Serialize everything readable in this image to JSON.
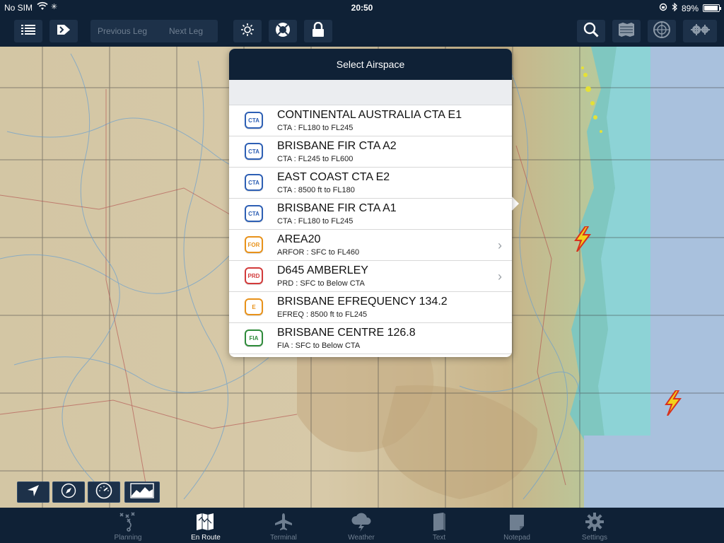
{
  "status": {
    "carrier": "No SIM",
    "time": "20:50",
    "battery_text": "89%",
    "battery_level": 0.89
  },
  "toolbar": {
    "previous_leg": "Previous Leg",
    "next_leg": "Next Leg"
  },
  "popover": {
    "title": "Select Airspace",
    "items": [
      {
        "badge": "CTA",
        "title": "CONTINENTAL AUSTRALIA CTA E1",
        "subtitle": "CTA : FL180 to FL245"
      },
      {
        "badge": "CTA",
        "title": "BRISBANE FIR CTA A2",
        "subtitle": "CTA : FL245 to FL600"
      },
      {
        "badge": "CTA",
        "title": "EAST COAST CTA E2",
        "subtitle": "CTA : 8500 ft to FL180"
      },
      {
        "badge": "CTA",
        "title": "BRISBANE FIR CTA A1",
        "subtitle": "CTA : FL180 to FL245"
      },
      {
        "badge": "FOR",
        "title": "AREA20",
        "subtitle": "ARFOR : SFC to FL460"
      },
      {
        "badge": "PRD",
        "title": "D645 AMBERLEY",
        "subtitle": "PRD : SFC to Below CTA"
      },
      {
        "badge": "E",
        "title": "BRISBANE EFREQUENCY 134.2",
        "subtitle": "EFREQ : 8500 ft to FL245"
      },
      {
        "badge": "FIA",
        "title": "BRISBANE CENTRE 126.8",
        "subtitle": "FIA : SFC to Below CTA"
      }
    ]
  },
  "colors": {
    "cta": "#2d5fb4",
    "for": "#e8921a",
    "prd": "#d23a3a",
    "e": "#e8921a",
    "fia": "#2e8b3a",
    "chrome": "#0f2136",
    "button": "#1d3149"
  },
  "tabs": [
    {
      "label": "Planning",
      "icon": "route-planning-icon"
    },
    {
      "label": "En Route",
      "icon": "map-icon"
    },
    {
      "label": "Terminal",
      "icon": "airplane-icon"
    },
    {
      "label": "Weather",
      "icon": "weather-cloud-icon"
    },
    {
      "label": "Text",
      "icon": "book-icon"
    },
    {
      "label": "Notepad",
      "icon": "notepad-icon"
    },
    {
      "label": "Settings",
      "icon": "gear-icon"
    }
  ]
}
